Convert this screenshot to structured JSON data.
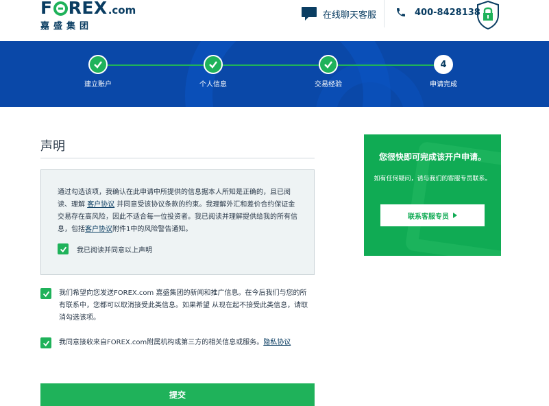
{
  "header": {
    "logo_word_left": "F",
    "logo_word_right": "REX",
    "logo_dotcom": ".com",
    "logo_sub": "嘉盛集团",
    "chat_label": "在线聊天客服",
    "phone_number": "400-8428138"
  },
  "progress": {
    "steps": [
      {
        "label": "建立账户",
        "status": "done"
      },
      {
        "label": "个人信息",
        "status": "done"
      },
      {
        "label": "交易经验",
        "status": "done"
      },
      {
        "label": "申请完成",
        "status": "current",
        "number": "4"
      }
    ]
  },
  "form": {
    "title": "声明",
    "declaration": {
      "text_1": "通过勾选该项，我确认在此申请中所提供的信息据本人所知是正确的，且已阅读、理解 ",
      "link_1": "客户协议",
      "text_2": " 并同意受该协议条款的约束。我理解外汇和差价合约保证金交易存在高风险，因此不适合每一位投资者。我已阅读并理解提供给我的所有信息，包括",
      "link_2": "客户协议",
      "text_3": "附件1中的风险警告通知。",
      "check_label": "我已阅读并同意以上声明"
    },
    "option_news": "我们希望向您发送FOREX.com 嘉盛集团的新闻和推广信息。在今后我们与您的所有联系中，您都可以取消接受此类信息。如果希望 从现在起不接受此类信息，请取消勾选该项。",
    "option_third_party_text": "我同意接收来自FOREX.com附属机构或第三方的相关信息或服务。",
    "option_third_party_link": "隐私协议",
    "submit_label": "提交"
  },
  "panel": {
    "title": "您很快即可完成该开户申请。",
    "subtitle": "如有任何疑问，请与我们的客服专员联系。",
    "button_label": "联系客服专员"
  },
  "colors": {
    "navy": "#0a3d62",
    "brand_blue": "#0a48a8",
    "brand_green": "#1fb25a",
    "panel_green": "#10ab54"
  },
  "icons": [
    "chat-icon",
    "phone-icon",
    "lock-shield-icon",
    "check-icon",
    "play-arrow-icon"
  ]
}
